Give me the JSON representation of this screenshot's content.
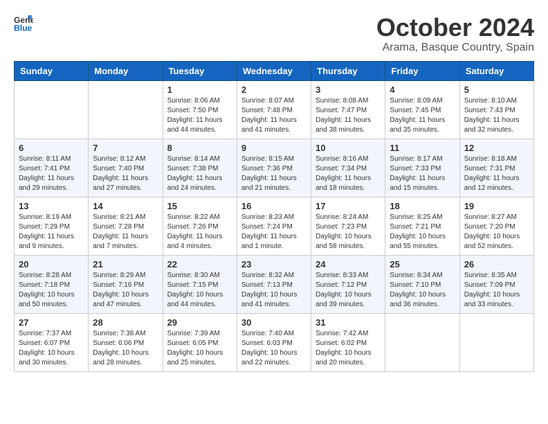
{
  "header": {
    "logo_general": "General",
    "logo_blue": "Blue",
    "month": "October 2024",
    "location": "Arama, Basque Country, Spain"
  },
  "days_of_week": [
    "Sunday",
    "Monday",
    "Tuesday",
    "Wednesday",
    "Thursday",
    "Friday",
    "Saturday"
  ],
  "weeks": [
    [
      {
        "day": "",
        "info": ""
      },
      {
        "day": "",
        "info": ""
      },
      {
        "day": "1",
        "info": "Sunrise: 8:06 AM\nSunset: 7:50 PM\nDaylight: 11 hours and 44 minutes."
      },
      {
        "day": "2",
        "info": "Sunrise: 8:07 AM\nSunset: 7:48 PM\nDaylight: 11 hours and 41 minutes."
      },
      {
        "day": "3",
        "info": "Sunrise: 8:08 AM\nSunset: 7:47 PM\nDaylight: 11 hours and 38 minutes."
      },
      {
        "day": "4",
        "info": "Sunrise: 8:09 AM\nSunset: 7:45 PM\nDaylight: 11 hours and 35 minutes."
      },
      {
        "day": "5",
        "info": "Sunrise: 8:10 AM\nSunset: 7:43 PM\nDaylight: 11 hours and 32 minutes."
      }
    ],
    [
      {
        "day": "6",
        "info": "Sunrise: 8:11 AM\nSunset: 7:41 PM\nDaylight: 11 hours and 29 minutes."
      },
      {
        "day": "7",
        "info": "Sunrise: 8:12 AM\nSunset: 7:40 PM\nDaylight: 11 hours and 27 minutes."
      },
      {
        "day": "8",
        "info": "Sunrise: 8:14 AM\nSunset: 7:38 PM\nDaylight: 11 hours and 24 minutes."
      },
      {
        "day": "9",
        "info": "Sunrise: 8:15 AM\nSunset: 7:36 PM\nDaylight: 11 hours and 21 minutes."
      },
      {
        "day": "10",
        "info": "Sunrise: 8:16 AM\nSunset: 7:34 PM\nDaylight: 11 hours and 18 minutes."
      },
      {
        "day": "11",
        "info": "Sunrise: 8:17 AM\nSunset: 7:33 PM\nDaylight: 11 hours and 15 minutes."
      },
      {
        "day": "12",
        "info": "Sunrise: 8:18 AM\nSunset: 7:31 PM\nDaylight: 11 hours and 12 minutes."
      }
    ],
    [
      {
        "day": "13",
        "info": "Sunrise: 8:19 AM\nSunset: 7:29 PM\nDaylight: 11 hours and 9 minutes."
      },
      {
        "day": "14",
        "info": "Sunrise: 8:21 AM\nSunset: 7:28 PM\nDaylight: 11 hours and 7 minutes."
      },
      {
        "day": "15",
        "info": "Sunrise: 8:22 AM\nSunset: 7:26 PM\nDaylight: 11 hours and 4 minutes."
      },
      {
        "day": "16",
        "info": "Sunrise: 8:23 AM\nSunset: 7:24 PM\nDaylight: 11 hours and 1 minute."
      },
      {
        "day": "17",
        "info": "Sunrise: 8:24 AM\nSunset: 7:23 PM\nDaylight: 10 hours and 58 minutes."
      },
      {
        "day": "18",
        "info": "Sunrise: 8:25 AM\nSunset: 7:21 PM\nDaylight: 10 hours and 55 minutes."
      },
      {
        "day": "19",
        "info": "Sunrise: 8:27 AM\nSunset: 7:20 PM\nDaylight: 10 hours and 52 minutes."
      }
    ],
    [
      {
        "day": "20",
        "info": "Sunrise: 8:28 AM\nSunset: 7:18 PM\nDaylight: 10 hours and 50 minutes."
      },
      {
        "day": "21",
        "info": "Sunrise: 8:29 AM\nSunset: 7:16 PM\nDaylight: 10 hours and 47 minutes."
      },
      {
        "day": "22",
        "info": "Sunrise: 8:30 AM\nSunset: 7:15 PM\nDaylight: 10 hours and 44 minutes."
      },
      {
        "day": "23",
        "info": "Sunrise: 8:32 AM\nSunset: 7:13 PM\nDaylight: 10 hours and 41 minutes."
      },
      {
        "day": "24",
        "info": "Sunrise: 8:33 AM\nSunset: 7:12 PM\nDaylight: 10 hours and 39 minutes."
      },
      {
        "day": "25",
        "info": "Sunrise: 8:34 AM\nSunset: 7:10 PM\nDaylight: 10 hours and 36 minutes."
      },
      {
        "day": "26",
        "info": "Sunrise: 8:35 AM\nSunset: 7:09 PM\nDaylight: 10 hours and 33 minutes."
      }
    ],
    [
      {
        "day": "27",
        "info": "Sunrise: 7:37 AM\nSunset: 6:07 PM\nDaylight: 10 hours and 30 minutes."
      },
      {
        "day": "28",
        "info": "Sunrise: 7:38 AM\nSunset: 6:06 PM\nDaylight: 10 hours and 28 minutes."
      },
      {
        "day": "29",
        "info": "Sunrise: 7:39 AM\nSunset: 6:05 PM\nDaylight: 10 hours and 25 minutes."
      },
      {
        "day": "30",
        "info": "Sunrise: 7:40 AM\nSunset: 6:03 PM\nDaylight: 10 hours and 22 minutes."
      },
      {
        "day": "31",
        "info": "Sunrise: 7:42 AM\nSunset: 6:02 PM\nDaylight: 10 hours and 20 minutes."
      },
      {
        "day": "",
        "info": ""
      },
      {
        "day": "",
        "info": ""
      }
    ]
  ]
}
